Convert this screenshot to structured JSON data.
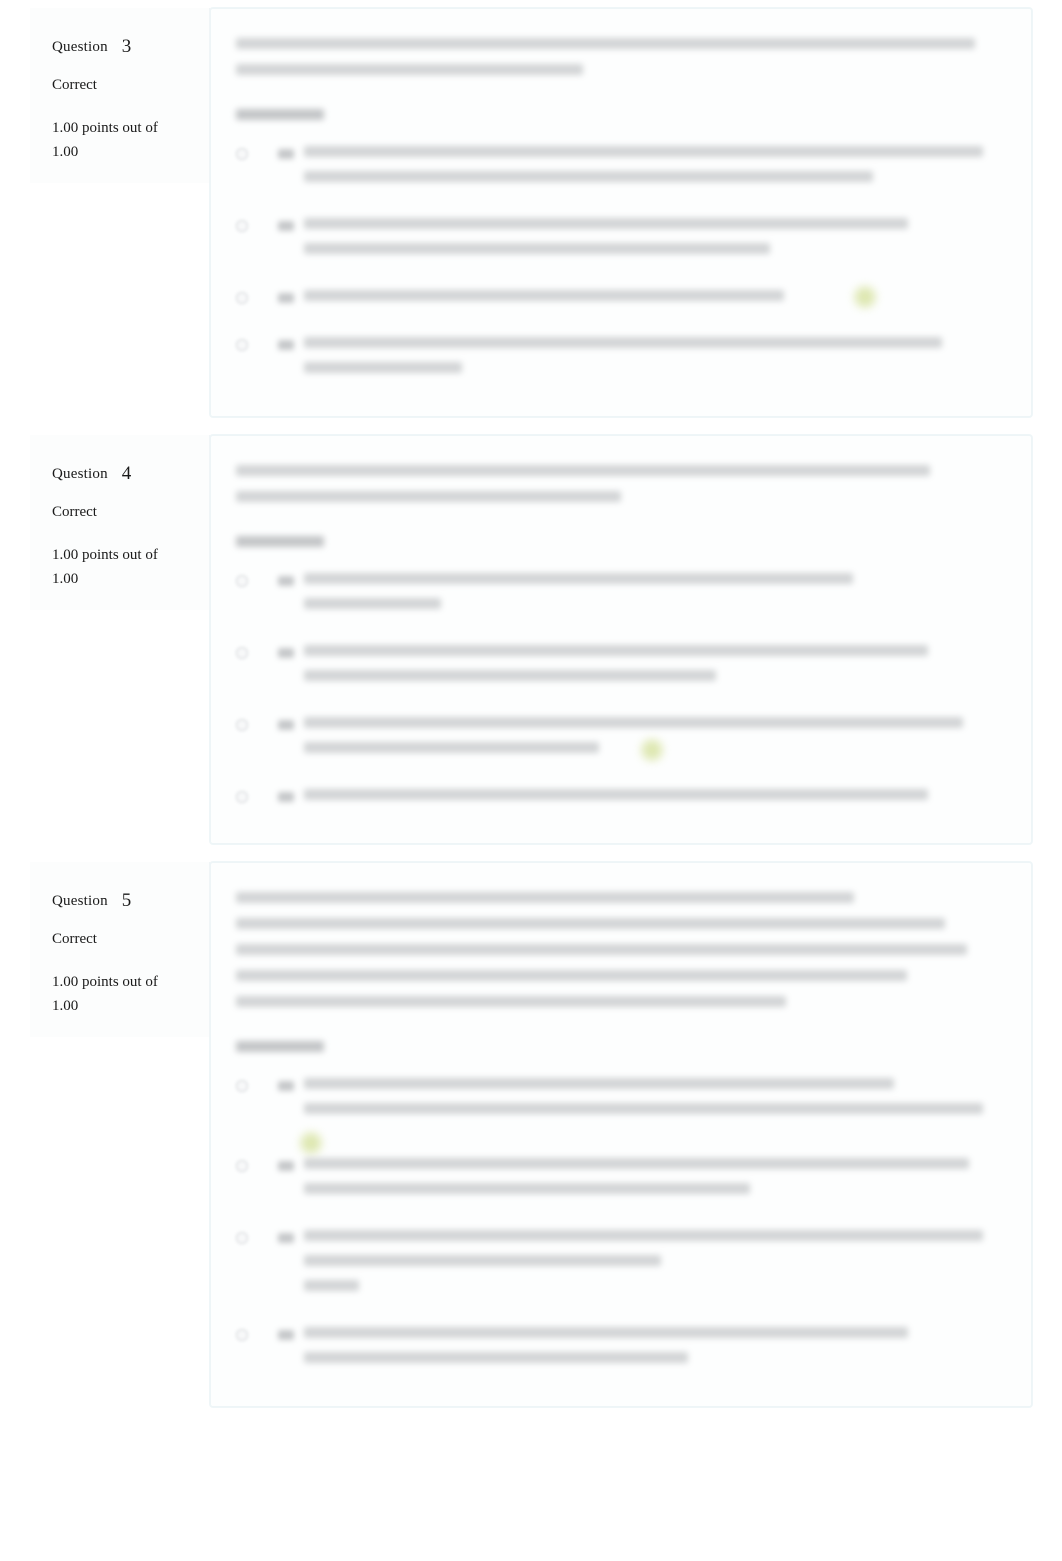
{
  "page": {
    "background_color": "#ffffff",
    "card_border_color": "#eef5f7",
    "card_background": "#fdfefe",
    "sidebar_background": "#fcfdfd",
    "correct_badge_color": "#cfdd8e",
    "content_state": "blurred-redacted"
  },
  "labels": {
    "question_word": "Question",
    "select_one": "Select one:",
    "option_letters": [
      "a.",
      "b.",
      "c.",
      "d."
    ]
  },
  "questions": [
    {
      "number": "3",
      "state": "Correct",
      "grade": "1.00 points out of 1.00",
      "grade_line_1": "1.00 points out of",
      "grade_line_2": "1.00",
      "stem_lines": 2,
      "options": [
        {
          "letter": "a.",
          "lines": 2,
          "correct": false
        },
        {
          "letter": "b.",
          "lines": 2,
          "correct": false
        },
        {
          "letter": "c.",
          "lines": 1,
          "correct": true
        },
        {
          "letter": "d.",
          "lines": 2,
          "correct": false
        }
      ]
    },
    {
      "number": "4",
      "state": "Correct",
      "grade": "1.00 points out of 1.00",
      "grade_line_1": "1.00 points out of",
      "grade_line_2": "1.00",
      "stem_lines": 2,
      "options": [
        {
          "letter": "a.",
          "lines": 2,
          "correct": false
        },
        {
          "letter": "b.",
          "lines": 2,
          "correct": false
        },
        {
          "letter": "c.",
          "lines": 2,
          "correct": true
        },
        {
          "letter": "d.",
          "lines": 1,
          "correct": false
        }
      ]
    },
    {
      "number": "5",
      "state": "Correct",
      "grade": "1.00 points out of 1.00",
      "grade_line_1": "1.00 points out of",
      "grade_line_2": "1.00",
      "stem_lines": 5,
      "options": [
        {
          "letter": "a.",
          "lines": 2,
          "correct": true
        },
        {
          "letter": "b.",
          "lines": 2,
          "correct": false
        },
        {
          "letter": "c.",
          "lines": 3,
          "correct": false
        },
        {
          "letter": "d.",
          "lines": 2,
          "correct": false
        }
      ]
    }
  ]
}
